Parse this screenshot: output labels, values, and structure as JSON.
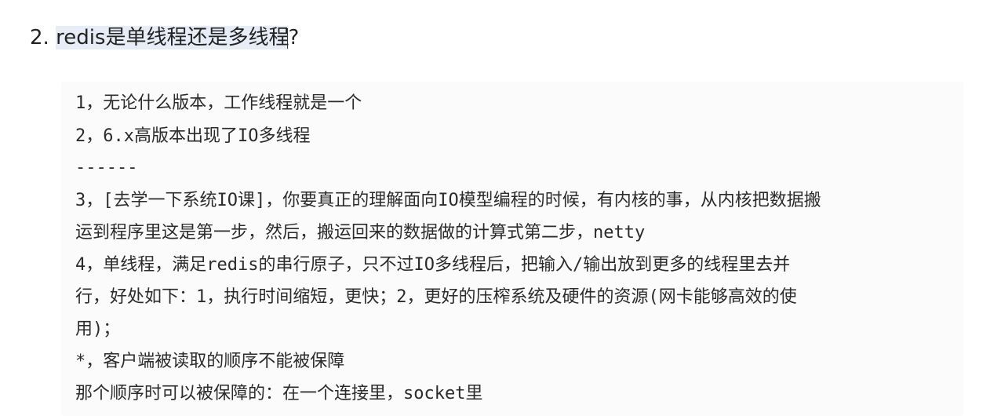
{
  "heading": {
    "number": "2. ",
    "selected_text": "redis是单线程还是多线程",
    "tail": "?"
  },
  "lines": [
    "1，无论什么版本，工作线程就是一个",
    "2，6.x高版本出现了IO多线程",
    "------",
    "3，[去学一下系统IO课]，你要真正的理解面向IO模型编程的时候，有内核的事，从内核把数据搬",
    "运到程序里这是第一步，然后，搬运回来的数据做的计算式第二步，netty",
    "4，单线程，满足redis的串行原子，只不过IO多线程后，把输入/输出放到更多的线程里去并",
    "行，好处如下：1，执行时间缩短，更快；2，更好的压榨系统及硬件的资源(网卡能够高效的使",
    "用)；",
    "*，客户端被读取的顺序不能被保障",
    "那个顺序时可以被保障的：在一个连接里，socket里"
  ]
}
